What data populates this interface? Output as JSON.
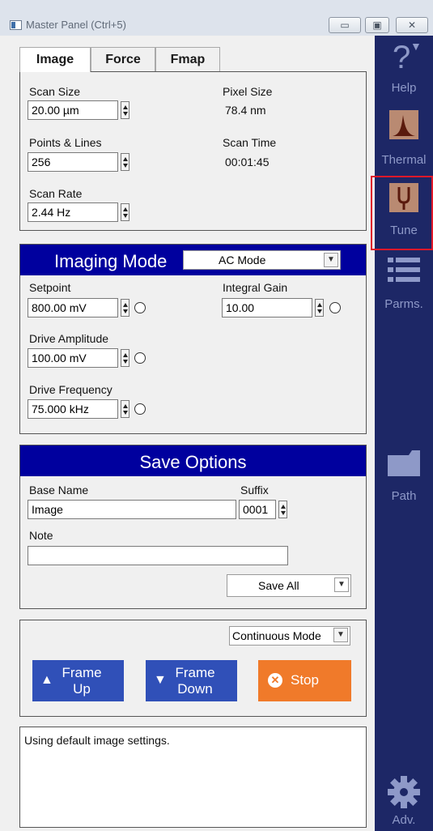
{
  "window": {
    "title": "Master Panel (Ctrl+5)",
    "min_glyph": "▭",
    "max_glyph": "▣",
    "close_glyph": "✕"
  },
  "tabs": [
    {
      "label": "Image",
      "active": true
    },
    {
      "label": "Force",
      "active": false
    },
    {
      "label": "Fmap",
      "active": false
    }
  ],
  "scan": {
    "scan_size_label": "Scan Size",
    "scan_size_value": "20.00 µm",
    "pixel_size_label": "Pixel Size",
    "pixel_size_value": "78.4 nm",
    "points_lines_label": "Points & Lines",
    "points_lines_value": "256",
    "scan_time_label": "Scan Time",
    "scan_time_value": "00:01:45",
    "scan_rate_label": "Scan Rate",
    "scan_rate_value": "2.44 Hz"
  },
  "imaging": {
    "title": "Imaging Mode",
    "mode_value": "AC Mode",
    "setpoint_label": "Setpoint",
    "setpoint_value": "800.00 mV",
    "integral_gain_label": "Integral Gain",
    "integral_gain_value": "10.00",
    "drive_amplitude_label": "Drive Amplitude",
    "drive_amplitude_value": "100.00 mV",
    "drive_frequency_label": "Drive Frequency",
    "drive_frequency_value": "75.000 kHz"
  },
  "save": {
    "title": "Save Options",
    "base_name_label": "Base Name",
    "base_name_value": "Image",
    "suffix_label": "Suffix",
    "suffix_value": "0001",
    "note_label": "Note",
    "note_value": "",
    "save_mode_value": "Save All"
  },
  "scan_control": {
    "mode_value": "Continuous Mode",
    "frame_up_line1": "Frame",
    "frame_up_line2": "Up",
    "frame_down_line1": "Frame",
    "frame_down_line2": "Down",
    "stop_label": "Stop"
  },
  "status": {
    "message": "Using default image settings."
  },
  "sidebar": {
    "help_glyph": "?",
    "help_label": "Help",
    "thermal_label": "Thermal",
    "tune_label": "Tune",
    "parms_label": "Parms.",
    "path_label": "Path",
    "adv_label": "Adv."
  },
  "colors": {
    "header_blue": "#00009e",
    "button_blue": "#3050b8",
    "stop_orange": "#f07a2a",
    "sidebar_navy": "#1d2766",
    "highlight_red": "#e0182a"
  }
}
